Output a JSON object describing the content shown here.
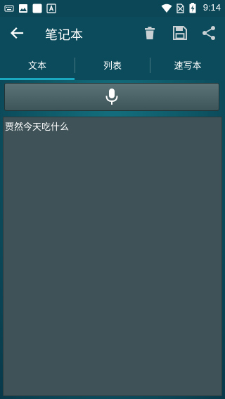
{
  "status_bar": {
    "time": "9:14",
    "icons": [
      "keyboard-icon",
      "image-icon",
      "blank-square-icon",
      "a-icon",
      "wifi-icon",
      "no-sim-icon",
      "battery-charging-icon"
    ]
  },
  "app_bar": {
    "title": "笔记本",
    "icons": [
      "back-arrow-icon",
      "trash-icon",
      "save-icon",
      "share-icon"
    ]
  },
  "tabs": {
    "items": [
      {
        "label": "文本",
        "selected": true
      },
      {
        "label": "列表",
        "selected": false
      },
      {
        "label": "速写本",
        "selected": false
      }
    ],
    "accent_color": "#1aa8c0"
  },
  "voice_input": {
    "icon": "microphone-icon"
  },
  "note": {
    "text": "贾然今天吃什么"
  }
}
